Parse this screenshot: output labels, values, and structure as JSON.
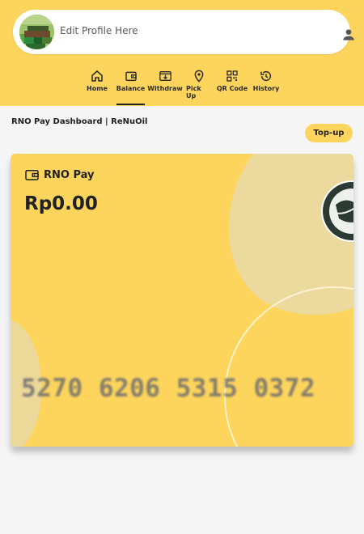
{
  "profile": {
    "label": "Edit Profile Here"
  },
  "nav": {
    "items": [
      {
        "label": "Home",
        "icon": "home-icon",
        "active": false
      },
      {
        "label": "Balance",
        "icon": "wallet-icon",
        "active": true
      },
      {
        "label": "Withdraw",
        "icon": "withdraw-icon",
        "active": false
      },
      {
        "label": "Pick Up",
        "icon": "location-pin-icon",
        "active": false
      },
      {
        "label": "QR Code",
        "icon": "qr-code-icon",
        "active": false
      },
      {
        "label": "History",
        "icon": "history-icon",
        "active": false
      }
    ]
  },
  "page": {
    "breadcrumb": "RNO Pay Dashboard | ReNuOil"
  },
  "actions": {
    "topup_label": "Top-up"
  },
  "card": {
    "title": "RNO Pay",
    "balance": "Rp0.00",
    "number": "5270 6206 5315 0372"
  },
  "colors": {
    "accent": "#fdd45c",
    "background": "#f5f5f5",
    "text": "#222222"
  }
}
